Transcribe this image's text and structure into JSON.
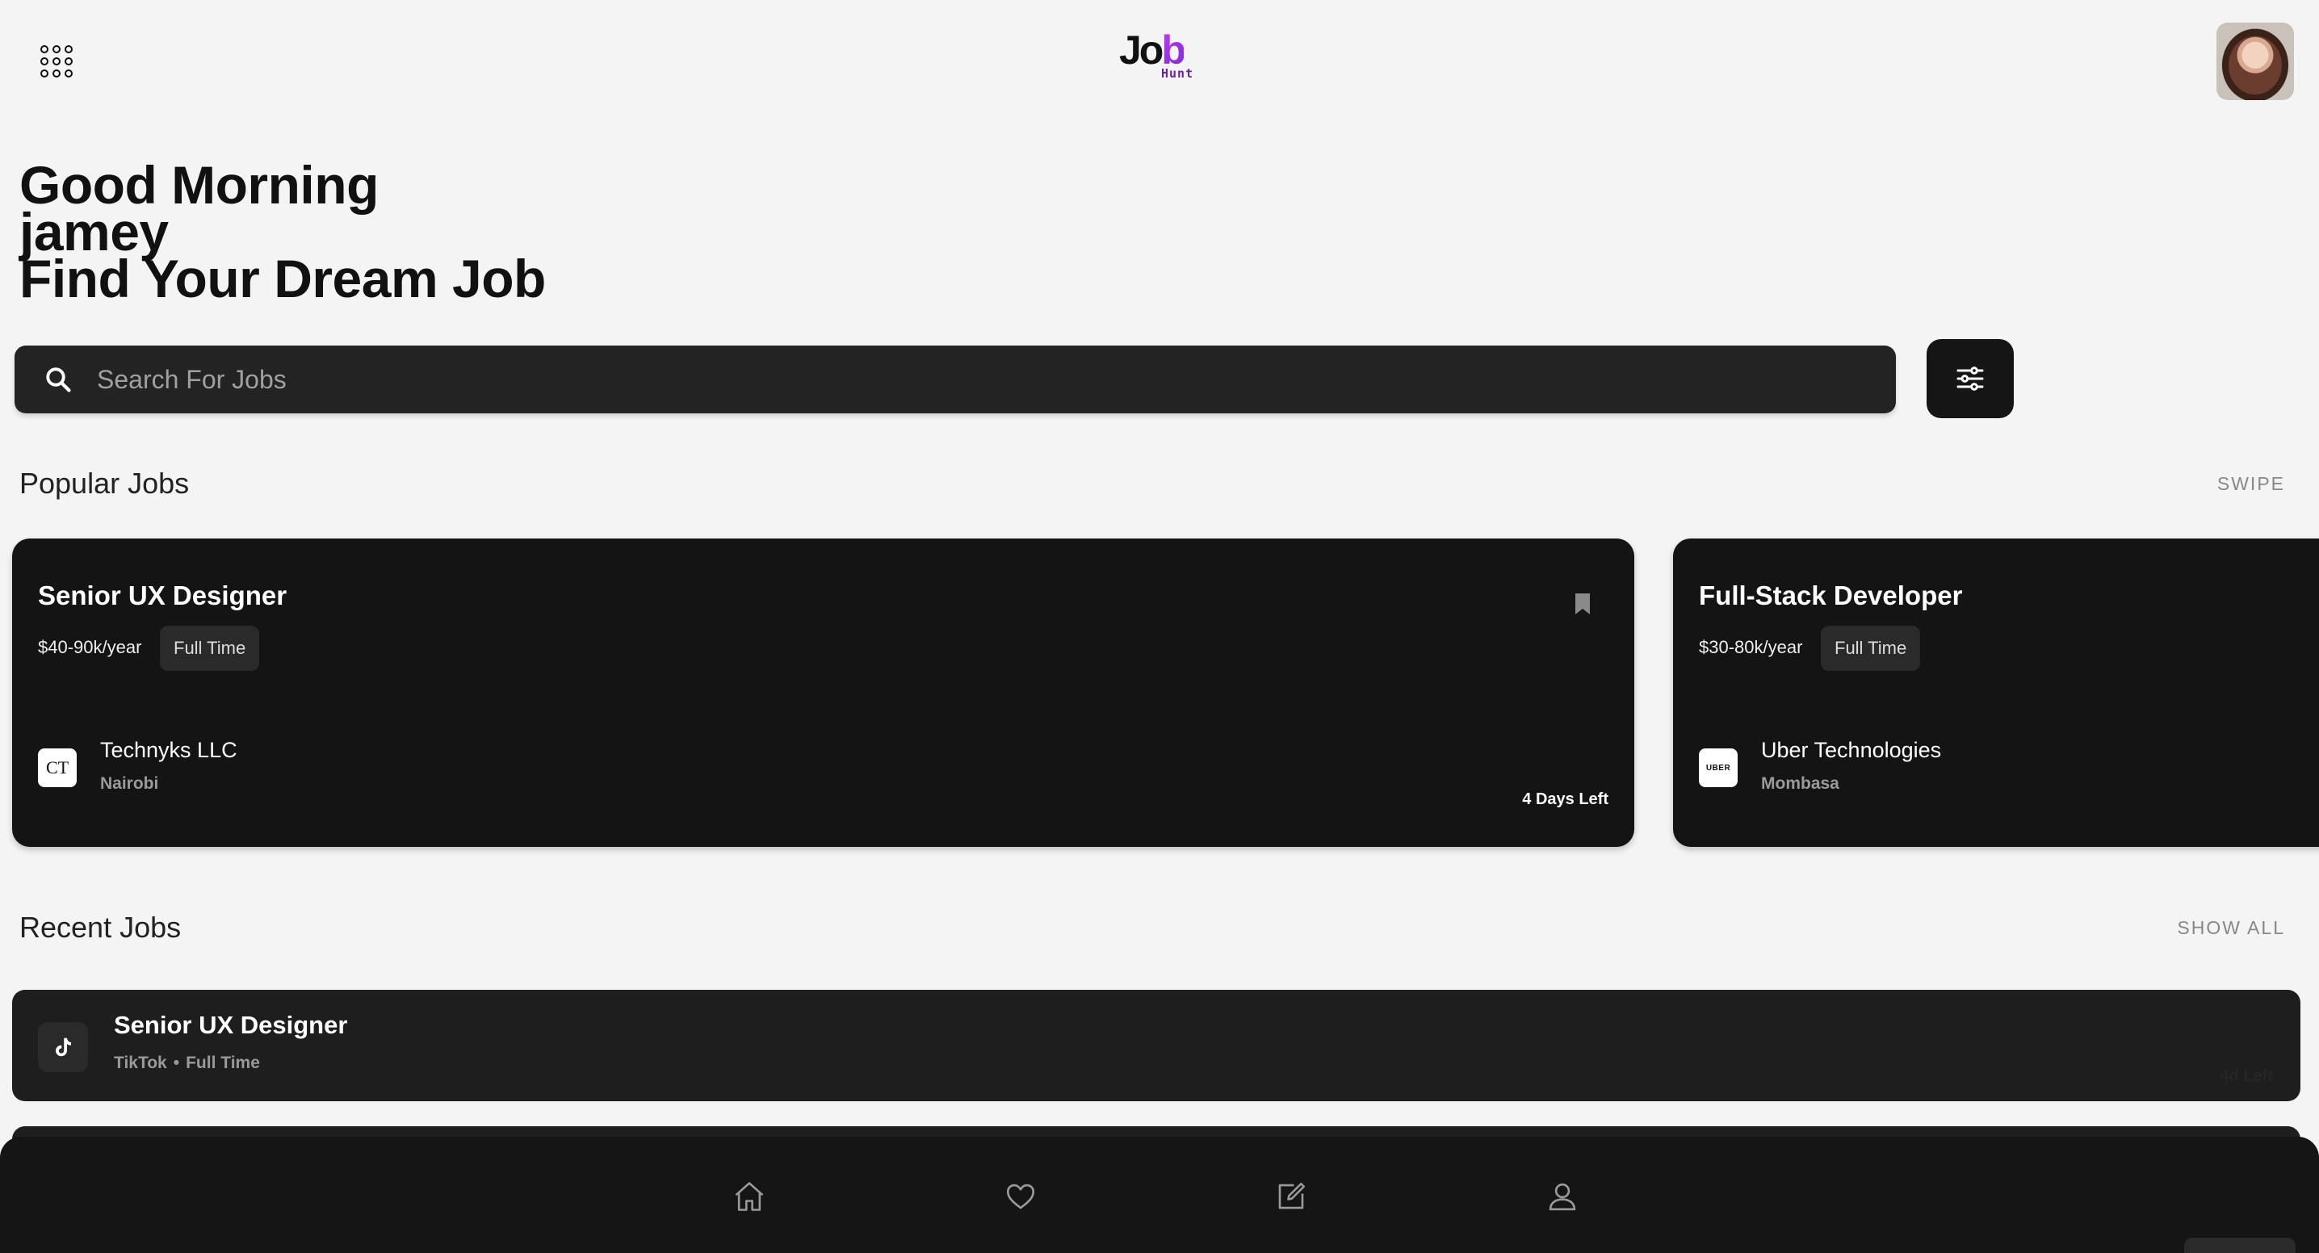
{
  "header": {
    "menu_icon": "grid-dots-icon",
    "logo_main_prefix": "Jo",
    "logo_main_accent": "b",
    "logo_sub": "Hunt"
  },
  "greeting": {
    "line1": "Good Morning",
    "line2": "jamey",
    "line3": "Find Your Dream Job"
  },
  "search": {
    "placeholder": "Search For Jobs"
  },
  "popular": {
    "title": "Popular Jobs",
    "action": "SWIPE",
    "jobs": [
      {
        "title": "Senior UX Designer",
        "salary": "$40-90k/year",
        "type": "Full Time",
        "logo_text": "CT",
        "company": "Technyks LLC",
        "city": "Nairobi",
        "days_left": "4 Days Left"
      },
      {
        "title": "Full-Stack Developer",
        "salary": "$30-80k/year",
        "type": "Full Time",
        "logo_text": "UBER",
        "company": "Uber Technologies",
        "city": "Mombasa"
      }
    ]
  },
  "recent": {
    "title": "Recent Jobs",
    "action": "SHOW ALL",
    "jobs": [
      {
        "title": "Senior UX Designer",
        "company": "TikTok",
        "separator": "•",
        "type": "Full Time",
        "ghost": "4d Left"
      }
    ]
  },
  "nav": {
    "items": [
      "home-icon",
      "heart-icon",
      "edit-icon",
      "user-icon"
    ]
  },
  "colors": {
    "background": "#f4f4f4",
    "card": "#141414",
    "logo_accent": "#b23be8"
  }
}
